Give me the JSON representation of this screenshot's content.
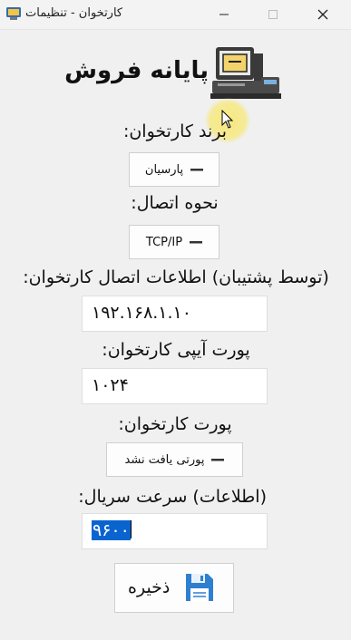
{
  "window": {
    "title": "کارتخوان - تنظیمات",
    "min_icon": "minimize-icon",
    "max_icon": "maximize-icon",
    "close_icon": "close-icon"
  },
  "header": {
    "title": "پایانه فروش",
    "icon": "pos-terminal-icon"
  },
  "form": {
    "brand_label": "برند کارتخوان:",
    "brand_value": "پارسیان",
    "connection_label": "نحوه اتصال:",
    "connection_value": "TCP/IP",
    "conn_info_label": "(توسط پشتیبان) اطلاعات اتصال کارتخوان:",
    "ip_value": "۱۹۲.۱۶۸.۱.۱۰",
    "port_ip_label": "پورت آیپی کارتخوان:",
    "port_ip_value": "۱۰۲۴",
    "serial_port_label": "پورت کارتخوان:",
    "serial_port_value": "پورتی یافت نشد",
    "baud_label": "(اطلاعات) سرعت سریال:",
    "baud_value": "۹۶۰۰"
  },
  "actions": {
    "save_label": "ذخیره",
    "save_icon": "floppy-disk-icon"
  },
  "colors": {
    "accent": "#0a64d0",
    "window_bg": "#f0f0f0"
  }
}
